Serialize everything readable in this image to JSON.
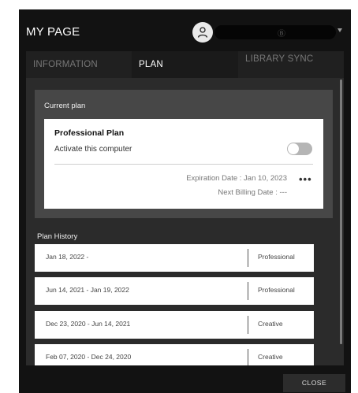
{
  "header": {
    "title": "MY PAGE",
    "user_name": "Ⓑ"
  },
  "tabs": [
    {
      "label": "INFORMATION",
      "active": false
    },
    {
      "label": "PLAN",
      "active": true
    },
    {
      "label": "LIBRARY SYNC",
      "active": false
    }
  ],
  "current_plan": {
    "section_label": "Current plan",
    "plan_name": "Professional Plan",
    "activate_label": "Activate this computer",
    "activate_on": false,
    "expiration": "Expiration Date : Jan 10, 2023",
    "next_billing": "Next Billing Date : ---"
  },
  "history": {
    "section_label": "Plan History",
    "rows": [
      {
        "period": "Jan 18, 2022 -",
        "plan": "Professional"
      },
      {
        "period": "Jun 14, 2021 - Jan 19, 2022",
        "plan": "Professional"
      },
      {
        "period": "Dec 23, 2020 - Jun 14, 2021",
        "plan": "Creative"
      },
      {
        "period": "Feb 07, 2020 - Dec 24, 2020",
        "plan": "Creative"
      }
    ]
  },
  "footer": {
    "close_label": "CLOSE"
  },
  "icons": {
    "avatar": "user-icon",
    "dropdown": "caret-down-icon",
    "more": "more-horizontal-icon"
  }
}
